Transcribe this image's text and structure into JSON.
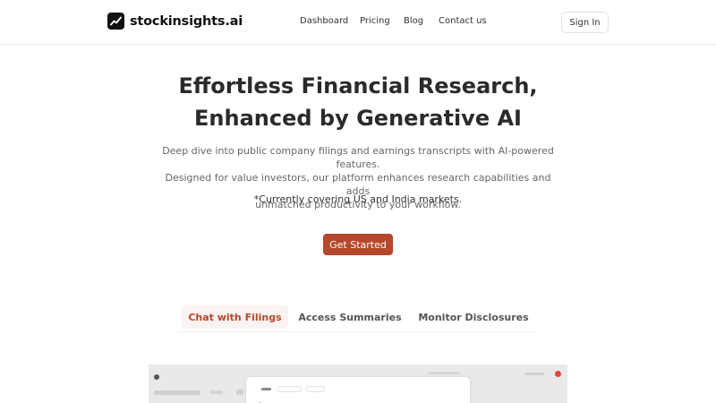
{
  "header": {
    "brand": "stockinsights.ai",
    "logo_icon": "trend-line-icon",
    "nav": [
      "Dashboard",
      "Pricing",
      "Blog",
      "Contact us"
    ],
    "signin_label": "Sign In"
  },
  "hero": {
    "title_line1": "Effortless Financial Research,",
    "title_line2": "Enhanced by Generative AI",
    "desc_line1": "Deep dive into public company filings and earnings transcripts with AI-powered features.",
    "desc_line2": "Designed for value investors, our platform enhances research capabilities and adds",
    "desc_line3": "unmatched productivity to your workflow.",
    "note": "*Currently covering US and India markets.",
    "cta_label": "Get Started"
  },
  "tabs": {
    "items": [
      "Chat with Filings",
      "Access Summaries",
      "Monitor Disclosures"
    ],
    "active_index": 0
  },
  "colors": {
    "accent": "#b5472b",
    "active_tab_bg": "#fbf3f1",
    "preview_bg": "#e9e9e9"
  }
}
